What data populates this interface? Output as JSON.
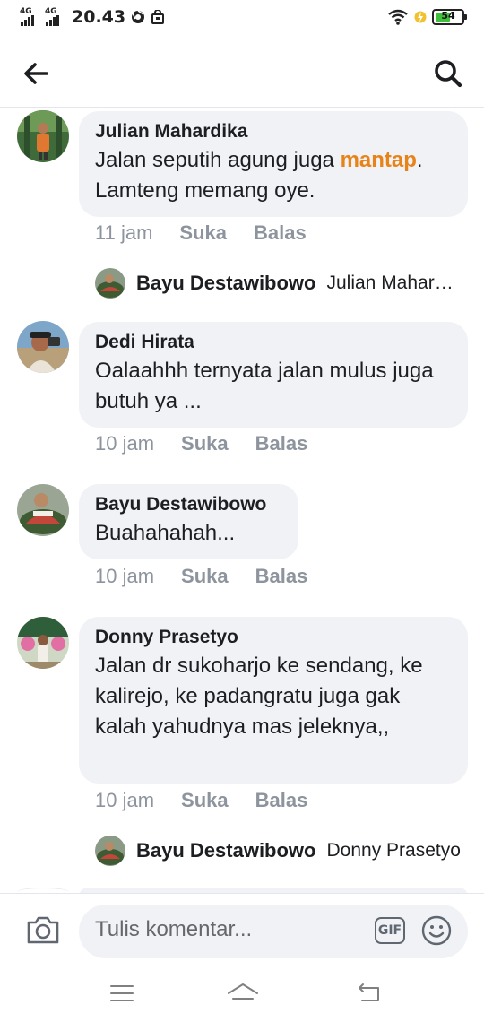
{
  "status_bar": {
    "network_1": "4G",
    "network_2": "4G",
    "time": "20.43",
    "battery_percent": "54"
  },
  "icons": {
    "back": "arrow-left-icon",
    "search": "search-icon",
    "camera": "camera-icon",
    "gif": "gif-icon",
    "emoji": "smiley-icon"
  },
  "comments": [
    {
      "author": "Julian Mahardika",
      "text_before": "Jalan seputih agung juga ",
      "link": "mantap",
      "text_after": ". Lamteng memang oye.",
      "time": "11 jam",
      "like": "Suka",
      "reply": "Balas",
      "reply_preview": {
        "author": "Bayu Destawibowo",
        "text": "Julian Mahardika"
      }
    },
    {
      "author": "Dedi Hirata",
      "text": "Oalaahhh ternyata jalan mulus juga butuh ya ...",
      "time": "10 jam",
      "like": "Suka",
      "reply": "Balas"
    },
    {
      "author": "Bayu Destawibowo",
      "text": "Buahahahah...",
      "time": "10 jam",
      "like": "Suka",
      "reply": "Balas"
    },
    {
      "author": "Donny Prasetyo",
      "text": "Jalan dr sukoharjo ke sendang, ke kalirejo, ke padangratu juga gak kalah yahudnya mas jeleknya,,",
      "time": "10 jam",
      "like": "Suka",
      "reply": "Balas",
      "reply_preview": {
        "author": "Bayu Destawibowo",
        "text": "Donny Prasetyo"
      }
    }
  ],
  "composer": {
    "placeholder": "Tulis komentar...",
    "gif_label": "GIF"
  },
  "colors": {
    "bubble": "#f0f2f5",
    "link": "#e8831a",
    "meta": "#8d949e",
    "battery": "#3fbf3a"
  }
}
